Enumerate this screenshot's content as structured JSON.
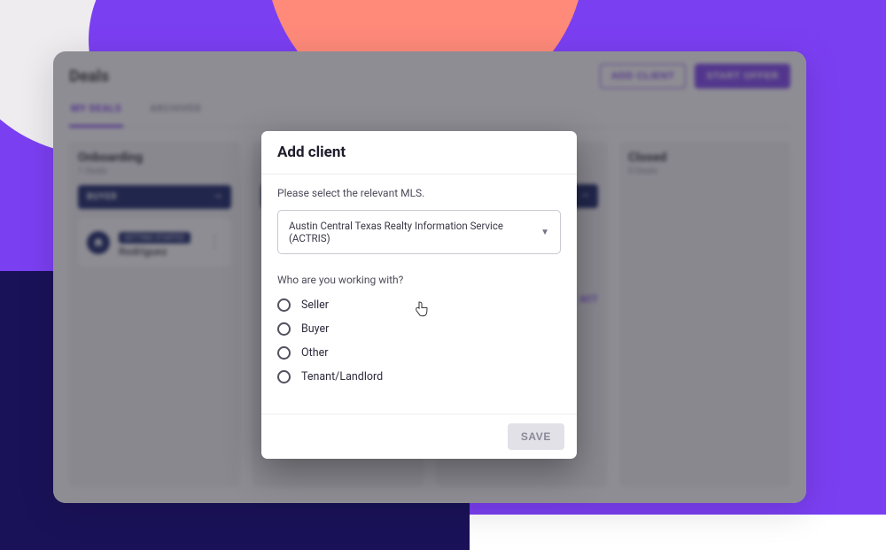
{
  "background": {
    "primary": "#7b3ff2",
    "dark_panel": "#1a1259",
    "coral": "#ff8a7a",
    "light": "#eeecef"
  },
  "app": {
    "title": "Deals",
    "buttons": {
      "add_client": "ADD CLIENT",
      "start_offer": "START OFFER"
    },
    "tabs": {
      "my_deals": "MY DEALS",
      "archived": "ARCHIVED"
    },
    "columns": [
      {
        "title": "Onboarding",
        "sub": "1 Deals",
        "badge": "BUYER",
        "card": {
          "chip": "GETTING STARTED",
          "name": "Rodriguez"
        }
      },
      {
        "title": "",
        "sub": "",
        "badge": "",
        "link": ""
      },
      {
        "title": "",
        "sub": "",
        "badge": "",
        "link": "ACT"
      },
      {
        "title": "Closed",
        "sub": "0 Deals"
      }
    ]
  },
  "modal": {
    "title": "Add client",
    "mls_label": "Please select the relevant MLS.",
    "mls_selected": "Austin Central Texas Realty Information Service (ACTRIS)",
    "working_label": "Who are you working with?",
    "options": [
      "Seller",
      "Buyer",
      "Other",
      "Tenant/Landlord"
    ],
    "save": "SAVE"
  }
}
